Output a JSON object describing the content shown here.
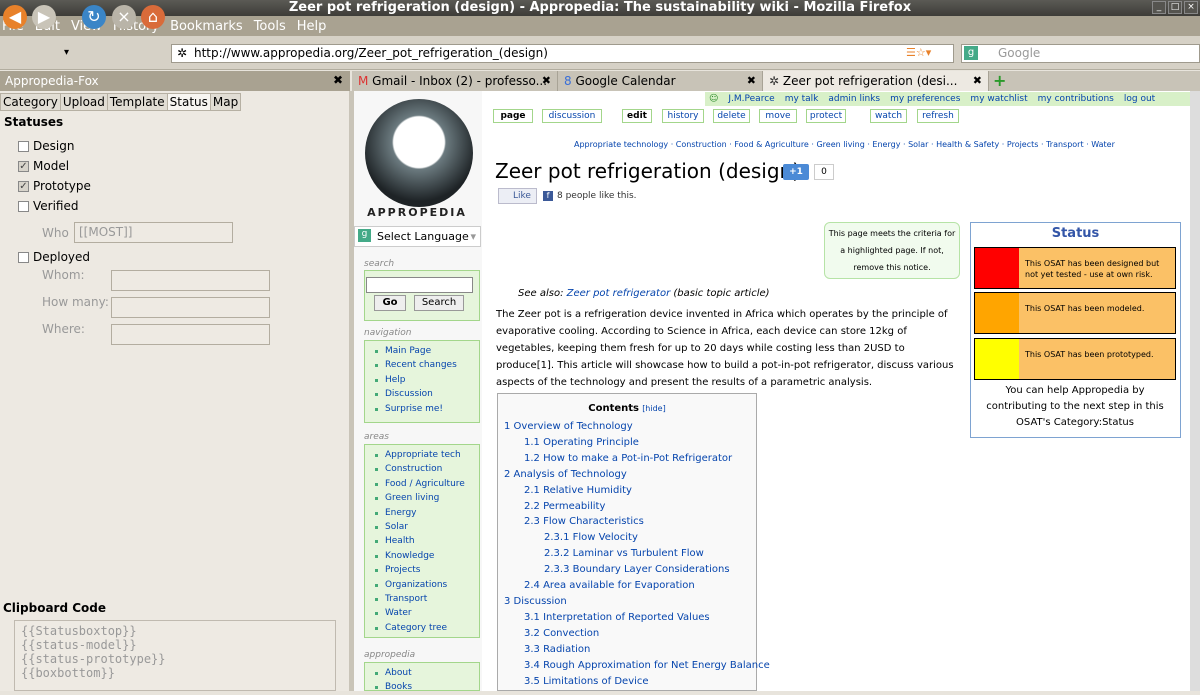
{
  "window": {
    "title": "Zeer pot refrigeration (design) - Appropedia: The sustainability wiki - Mozilla Firefox"
  },
  "menu": [
    "File",
    "Edit",
    "View",
    "History",
    "Bookmarks",
    "Tools",
    "Help"
  ],
  "url": "http://www.appropedia.org/Zeer_pot_refrigeration_(design)",
  "search_placeholder": "Google",
  "sidebar": {
    "title": "Appropedia-Fox",
    "tabs": [
      "Category",
      "Upload",
      "Template",
      "Status",
      "Map"
    ],
    "statuses_heading": "Statuses",
    "checks": [
      {
        "label": "Design",
        "checked": false
      },
      {
        "label": "Model",
        "checked": true
      },
      {
        "label": "Prototype",
        "checked": true
      },
      {
        "label": "Verified",
        "checked": false
      }
    ],
    "who_label": "Who",
    "who_value": "[[MOST]]",
    "deployed_label": "Deployed",
    "whom_label": "Whom:",
    "howmany_label": "How many:",
    "where_label": "Where:",
    "clipboard_heading": "Clipboard Code",
    "clipboard_lines": [
      "{{Statusboxtop}}",
      "{{status-model}}",
      "{{status-prototype}}",
      "{{boxbottom}}"
    ]
  },
  "tabs": [
    {
      "label": "Gmail - Inbox (2) - professo...",
      "active": false
    },
    {
      "label": "Google Calendar",
      "active": false
    },
    {
      "label": "Zeer pot refrigeration (desi...",
      "active": true
    }
  ],
  "wiki": {
    "logo_text": "APPROPEDIA",
    "select_language": "Select Language",
    "search_label": "search",
    "go": "Go",
    "search_btn": "Search",
    "navigation_label": "navigation",
    "navigation": [
      "Main Page",
      "Recent changes",
      "Help",
      "Discussion",
      "Surprise me!"
    ],
    "areas_label": "areas",
    "areas": [
      "Appropriate tech",
      "Construction",
      "Food / Agriculture",
      "Green living",
      "Energy",
      "Solar",
      "Health",
      "Knowledge",
      "Projects",
      "Organizations",
      "Transport",
      "Water",
      "Category tree"
    ],
    "appropedia_label": "appropedia",
    "appropedia": [
      "About",
      "Books"
    ],
    "userbar": [
      "J.M.Pearce",
      "my talk",
      "admin links",
      "my preferences",
      "my watchlist",
      "my contributions",
      "log out"
    ],
    "page_tabs": [
      "page",
      "discussion",
      "edit",
      "history",
      "delete",
      "move",
      "protect",
      "watch",
      "refresh"
    ],
    "categories": "Appropriate technology · Construction · Food & Agriculture · Green living · Energy · Solar · Health & Safety · Projects · Transport · Water",
    "title": "Zeer pot refrigeration (design)",
    "gplus": "+1",
    "gplus_count": "0",
    "like": "Like",
    "like_text": "8 people like this.",
    "criteria_note": [
      "This page meets the criteria for",
      "a highlighted page. If not,",
      "remove this notice."
    ],
    "see_also_prefix": "See also: ",
    "see_also_link": "Zeer pot refrigerator",
    "see_also_suffix": " (basic topic article)",
    "body": "The Zeer pot is a refrigeration device invented in Africa which operates by the principle of evaporative cooling. According to Science in Africa, each device can store 12kg of vegetables, keeping them fresh for up to 20 days while costing less than 2USD to produce[1]. This article will showcase how to build a pot-in-pot refrigerator, discuss various aspects of the technology and present the results of a parametric analysis.",
    "status": {
      "heading": "Status",
      "rows": [
        {
          "color": "#ff0000",
          "text": "This OSAT has been designed but not yet tested - use at own risk."
        },
        {
          "color": "#ffa500",
          "text": "This OSAT has been modeled."
        },
        {
          "color": "#ffff00",
          "text": "This OSAT has been prototyped."
        }
      ],
      "footer": "You can help Appropedia by contributing to the next step in this OSAT's Category:Status"
    },
    "toc": {
      "heading": "Contents",
      "hide": "[hide]",
      "items": [
        {
          "t": "1 Overview of Technology",
          "l": 0
        },
        {
          "t": "1.1 Operating Principle",
          "l": 1
        },
        {
          "t": "1.2 How to make a Pot-in-Pot Refrigerator",
          "l": 1
        },
        {
          "t": "2 Analysis of Technology",
          "l": 0
        },
        {
          "t": "2.1 Relative Humidity",
          "l": 1
        },
        {
          "t": "2.2 Permeability",
          "l": 1
        },
        {
          "t": "2.3 Flow Characteristics",
          "l": 1
        },
        {
          "t": "2.3.1 Flow Velocity",
          "l": 2
        },
        {
          "t": "2.3.2 Laminar vs Turbulent Flow",
          "l": 2
        },
        {
          "t": "2.3.3 Boundary Layer Considerations",
          "l": 2
        },
        {
          "t": "2.4 Area available for Evaporation",
          "l": 1
        },
        {
          "t": "3 Discussion",
          "l": 0
        },
        {
          "t": "3.1 Interpretation of Reported Values",
          "l": 1
        },
        {
          "t": "3.2 Convection",
          "l": 1
        },
        {
          "t": "3.3 Radiation",
          "l": 1
        },
        {
          "t": "3.4 Rough Approximation for Net Energy Balance",
          "l": 1
        },
        {
          "t": "3.5 Limitations of Device",
          "l": 1
        }
      ]
    }
  }
}
